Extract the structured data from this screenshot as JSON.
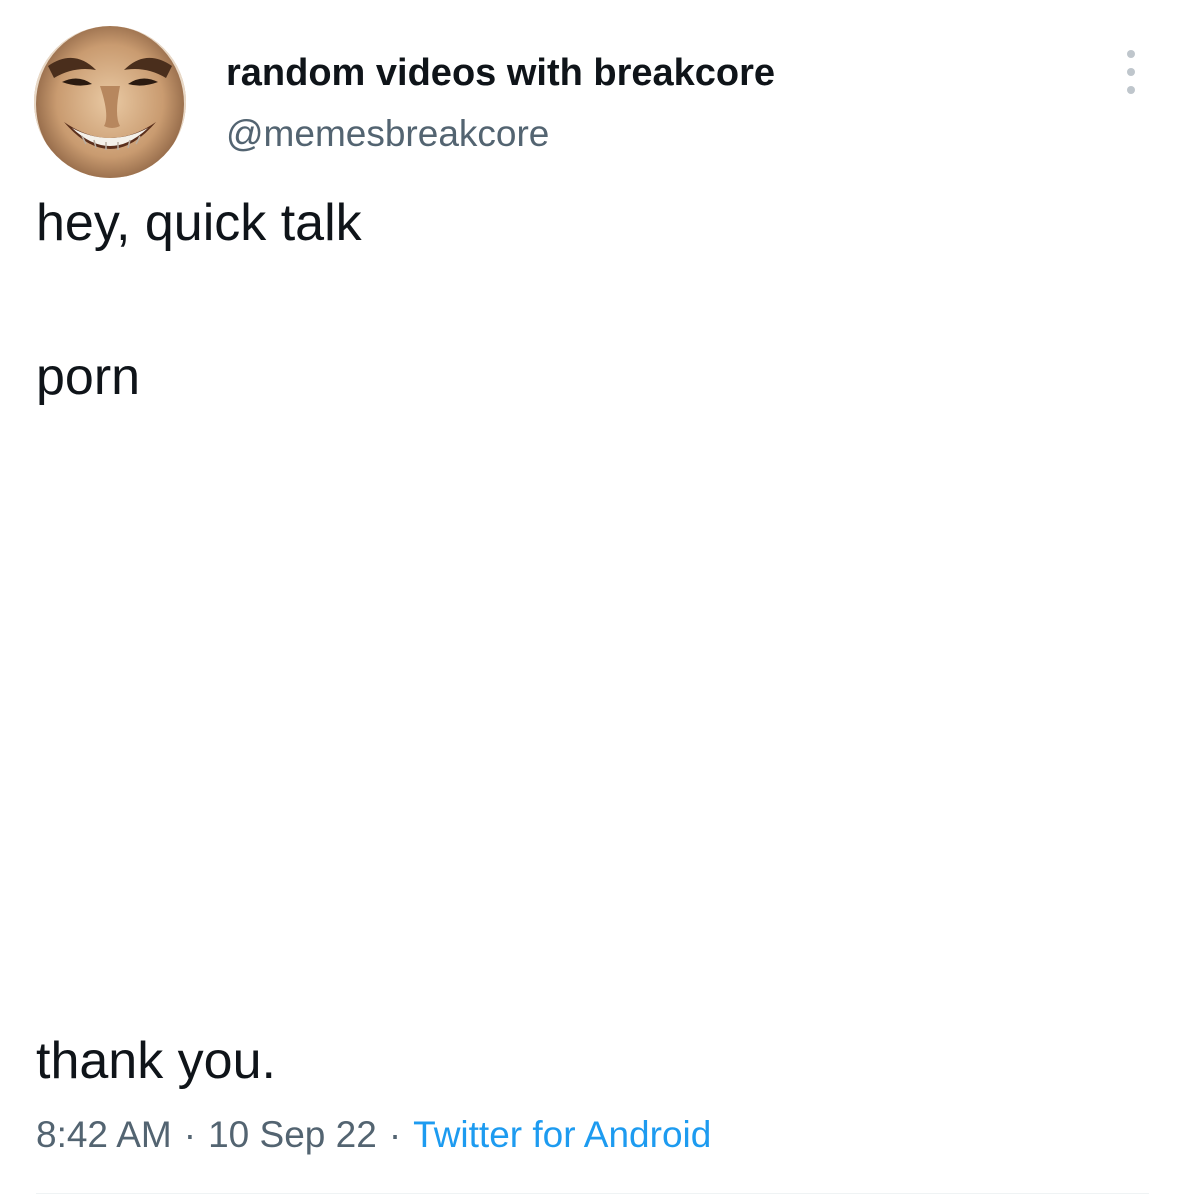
{
  "tweet": {
    "display_name": "random videos with breakcore",
    "handle": "@memesbreakcore",
    "more_icon": "more-vertical-icon",
    "lines": [
      "hey, quick talk",
      "porn",
      "thank you."
    ],
    "time": "8:42 AM",
    "date": "10 Sep 22",
    "separator": "·",
    "source": "Twitter for Android"
  },
  "colors": {
    "text": "#0f1419",
    "secondary": "#536471",
    "link": "#1d9bf0",
    "divider": "#eff3f4"
  }
}
